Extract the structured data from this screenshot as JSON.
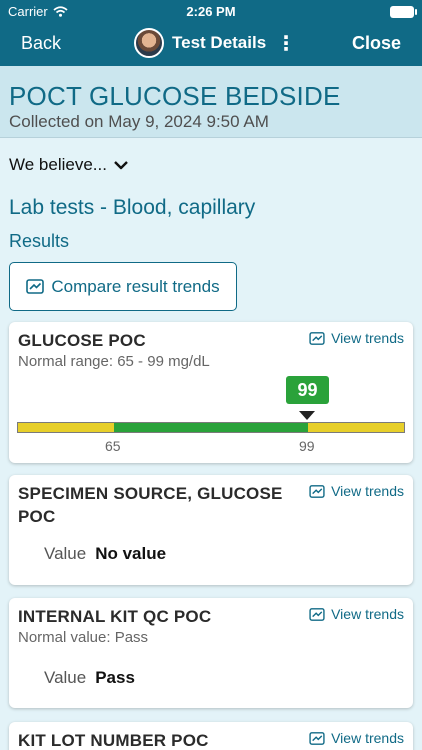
{
  "status": {
    "carrier": "Carrier",
    "time": "2:26 PM"
  },
  "nav": {
    "back": "Back",
    "title": "Test Details",
    "close": "Close"
  },
  "header": {
    "test_name": "POCT GLUCOSE BEDSIDE",
    "collected": "Collected on May 9, 2024 9:50 AM"
  },
  "believe": "We believe...",
  "section": {
    "title": "Lab tests - Blood, capillary",
    "results": "Results",
    "compare": "Compare result trends"
  },
  "cards": [
    {
      "name": "GLUCOSE POC",
      "trends": "View trends",
      "range": "Normal range: 65 - 99 mg/dL",
      "value": "99",
      "low": "65",
      "high": "99"
    },
    {
      "name_line1": "SPECIMEN SOURCE, GLUCOSE",
      "name_line2": "POC",
      "trends": "View trends",
      "value_label": "Value",
      "value": "No value"
    },
    {
      "name": "INTERNAL KIT QC POC",
      "trends": "View trends",
      "range": "Normal value: Pass",
      "value_label": "Value",
      "value": "Pass"
    },
    {
      "name": "KIT LOT NUMBER POC",
      "trends": "View trends"
    }
  ],
  "colors": {
    "primary": "#106a86",
    "in_range": "#2aa23a",
    "out_range": "#e7cf2a"
  }
}
